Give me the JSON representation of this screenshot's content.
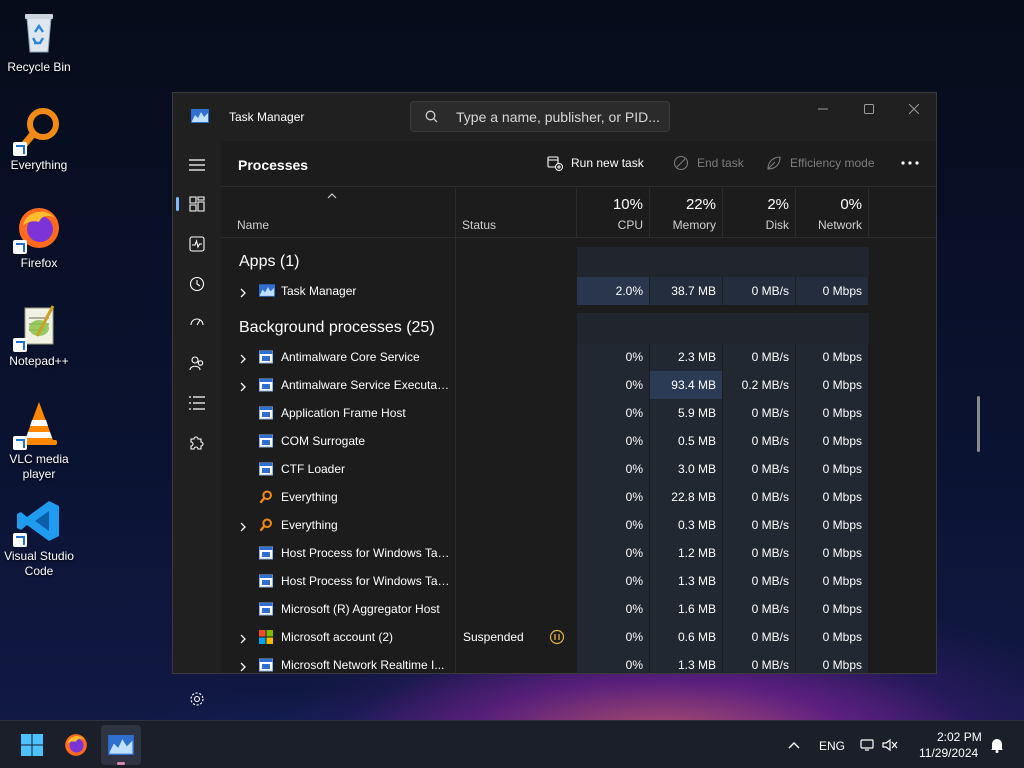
{
  "desktop": {
    "icons": [
      {
        "label": "Recycle Bin",
        "icon": "recycle-bin-icon"
      },
      {
        "label": "Everything",
        "icon": "everything-icon"
      },
      {
        "label": "Firefox",
        "icon": "firefox-icon"
      },
      {
        "label": "Notepad++",
        "icon": "notepad-plus-plus-icon"
      },
      {
        "label": "VLC media player",
        "icon": "vlc-icon"
      },
      {
        "label": "Visual Studio Code",
        "icon": "vscode-icon"
      }
    ]
  },
  "window": {
    "title": "Task Manager",
    "search_placeholder": "Type a name, publisher, or PID...",
    "page_title": "Processes",
    "toolbar": {
      "run_new_task": "Run new task",
      "end_task": "End task",
      "efficiency_mode": "Efficiency mode",
      "more": "•••"
    },
    "columns": {
      "name": "Name",
      "status": "Status",
      "cpu_pct": "10%",
      "cpu": "CPU",
      "memory_pct": "22%",
      "memory": "Memory",
      "disk_pct": "2%",
      "disk": "Disk",
      "network_pct": "0%",
      "network": "Network"
    },
    "sections": {
      "apps": "Apps (1)",
      "background": "Background processes (25)"
    },
    "apps": [
      {
        "name": "Task Manager",
        "status": "",
        "cpu": "2.0%",
        "memory": "38.7 MB",
        "disk": "0 MB/s",
        "network": "0 Mbps",
        "expandable": true,
        "icon": "task-manager-icon"
      }
    ],
    "background": [
      {
        "name": "Antimalware Core Service",
        "status": "",
        "cpu": "0%",
        "memory": "2.3 MB",
        "disk": "0 MB/s",
        "network": "0 Mbps",
        "expandable": true,
        "icon": "service-icon"
      },
      {
        "name": "Antimalware Service Executable",
        "status": "",
        "cpu": "0%",
        "memory": "93.4 MB",
        "disk": "0.2 MB/s",
        "network": "0 Mbps",
        "expandable": true,
        "icon": "service-icon"
      },
      {
        "name": "Application Frame Host",
        "status": "",
        "cpu": "0%",
        "memory": "5.9 MB",
        "disk": "0 MB/s",
        "network": "0 Mbps",
        "expandable": false,
        "icon": "service-icon"
      },
      {
        "name": "COM Surrogate",
        "status": "",
        "cpu": "0%",
        "memory": "0.5 MB",
        "disk": "0 MB/s",
        "network": "0 Mbps",
        "expandable": false,
        "icon": "service-icon"
      },
      {
        "name": "CTF Loader",
        "status": "",
        "cpu": "0%",
        "memory": "3.0 MB",
        "disk": "0 MB/s",
        "network": "0 Mbps",
        "expandable": false,
        "icon": "service-icon"
      },
      {
        "name": "Everything",
        "status": "",
        "cpu": "0%",
        "memory": "22.8 MB",
        "disk": "0 MB/s",
        "network": "0 Mbps",
        "expandable": false,
        "icon": "everything-icon"
      },
      {
        "name": "Everything",
        "status": "",
        "cpu": "0%",
        "memory": "0.3 MB",
        "disk": "0 MB/s",
        "network": "0 Mbps",
        "expandable": true,
        "icon": "everything-icon"
      },
      {
        "name": "Host Process for Windows Tasks",
        "status": "",
        "cpu": "0%",
        "memory": "1.2 MB",
        "disk": "0 MB/s",
        "network": "0 Mbps",
        "expandable": false,
        "icon": "service-icon"
      },
      {
        "name": "Host Process for Windows Tasks",
        "status": "",
        "cpu": "0%",
        "memory": "1.3 MB",
        "disk": "0 MB/s",
        "network": "0 Mbps",
        "expandable": false,
        "icon": "service-icon"
      },
      {
        "name": "Microsoft (R) Aggregator Host",
        "status": "",
        "cpu": "0%",
        "memory": "1.6 MB",
        "disk": "0 MB/s",
        "network": "0 Mbps",
        "expandable": false,
        "icon": "service-icon"
      },
      {
        "name": "Microsoft account (2)",
        "status": "Suspended",
        "cpu": "0%",
        "memory": "0.6 MB",
        "disk": "0 MB/s",
        "network": "0 Mbps",
        "expandable": true,
        "icon": "microsoft-logo-icon"
      },
      {
        "name": "Microsoft Network Realtime I...",
        "status": "",
        "cpu": "0%",
        "memory": "1.3 MB",
        "disk": "0 MB/s",
        "network": "0 Mbps",
        "expandable": true,
        "icon": "service-icon"
      }
    ]
  },
  "taskbar": {
    "language": "ENG",
    "time": "2:02 PM",
    "date": "11/29/2024"
  },
  "colors": {
    "accent": "#7fb8ff",
    "heat_light": "#1f2a3e",
    "heat_medium": "#263a5c",
    "window_bg": "#1c1c1c"
  }
}
